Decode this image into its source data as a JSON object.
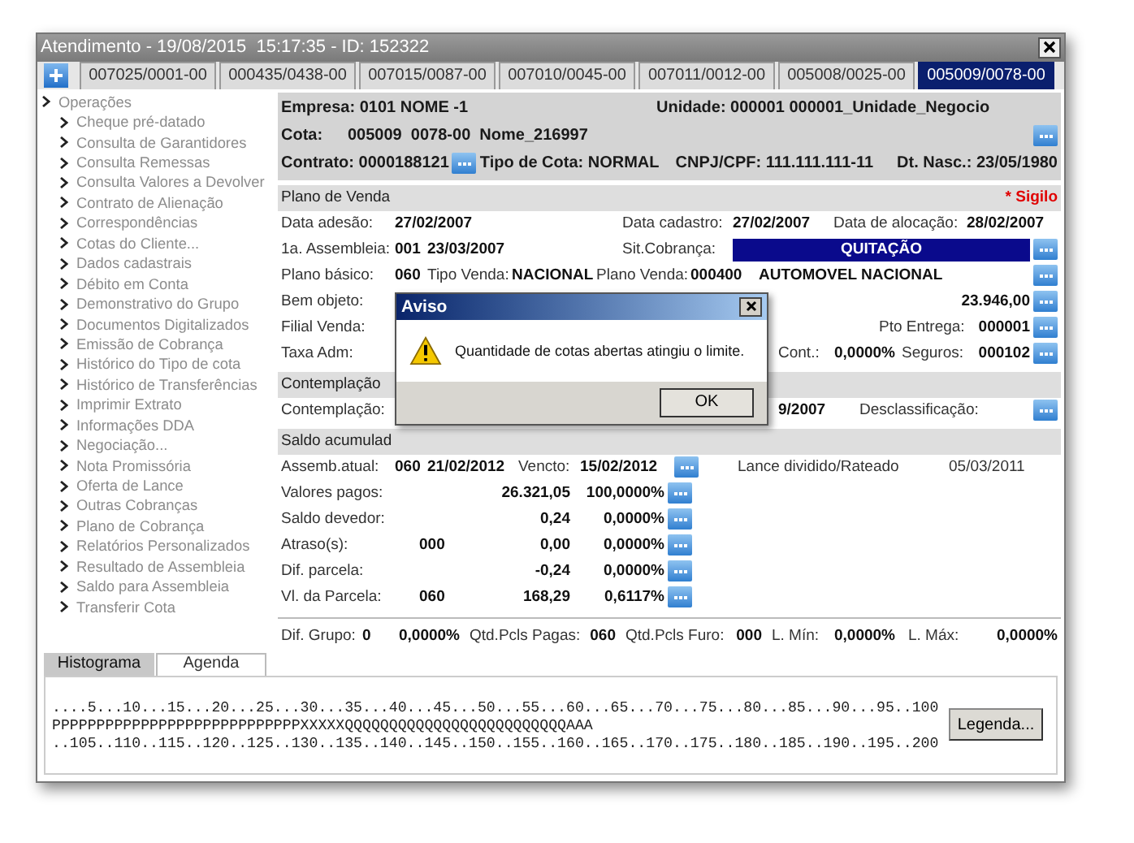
{
  "window": {
    "title": "Atendimento - 19/08/2015  15:17:35 - ID: 152322"
  },
  "tabs": [
    {
      "label": "007025/0001-00",
      "selected": false
    },
    {
      "label": "000435/0438-00",
      "selected": false
    },
    {
      "label": "007015/0087-00",
      "selected": false
    },
    {
      "label": "007010/0045-00",
      "selected": false
    },
    {
      "label": "007011/0012-00",
      "selected": false
    },
    {
      "label": "005008/0025-00",
      "selected": false
    },
    {
      "label": "005009/0078-00",
      "selected": true
    }
  ],
  "sidebar": {
    "items": [
      {
        "label": "Operações",
        "children": [
          {
            "label": "Cheque pré-datado"
          },
          {
            "label": "Consulta de Garantidores"
          },
          {
            "label": "Consulta Remessas"
          },
          {
            "label": "Consulta Valores a Devolver"
          },
          {
            "label": "Contrato de Alienação"
          },
          {
            "label": "Correspondências"
          },
          {
            "label": "Cotas do Cliente..."
          },
          {
            "label": "Dados cadastrais"
          },
          {
            "label": "Débito em Conta"
          },
          {
            "label": "Demonstrativo do Grupo"
          },
          {
            "label": "Documentos Digitalizados"
          },
          {
            "label": "Emissão de Cobrança"
          },
          {
            "label": "Histórico do Tipo de cota"
          },
          {
            "label": "Histórico de Transferências"
          },
          {
            "label": "Imprimir Extrato"
          },
          {
            "label": "Informações DDA"
          },
          {
            "label": "Negociação..."
          },
          {
            "label": "Nota Promissória"
          },
          {
            "label": "Oferta de Lance"
          },
          {
            "label": "Outras Cobranças"
          },
          {
            "label": "Plano de Cobrança"
          },
          {
            "label": "Relatórios Personalizados"
          },
          {
            "label": "Resultado de Assembleia"
          },
          {
            "label": "Saldo para Assembleia"
          },
          {
            "label": "Transferir Cota"
          }
        ]
      }
    ]
  },
  "header": {
    "empresa": "Empresa: 0101 NOME -1",
    "unidade": "Unidade: 000001 000001_Unidade_Negocio",
    "cota_label": "Cota:",
    "cota": "005009  0078-00  Nome_216997",
    "contrato": "Contrato: 0000188121",
    "tipo_cota": "Tipo de Cota: NORMAL",
    "cnpj": "CNPJ/CPF: 111.111.111-11",
    "nascimento": "Dt. Nasc.: 23/05/1980"
  },
  "sections": [
    {
      "title": "Plano de Venda",
      "note": "* Sigilo",
      "rows": [
        {
          "fields": [
            {
              "kind": "label",
              "text": "Data adesão:"
            },
            {
              "kind": "value",
              "text": "27/02/2007"
            },
            {
              "kind": "label",
              "text": "Data cadastro:"
            },
            {
              "kind": "value",
              "text": "27/02/2007"
            },
            {
              "kind": "label",
              "text": "Data de alocação:"
            },
            {
              "kind": "value",
              "text": "28/02/2007"
            }
          ]
        },
        {
          "fields": [
            {
              "kind": "label",
              "text": "1a. Assembleia:"
            },
            {
              "kind": "value",
              "text": "001"
            },
            {
              "kind": "value",
              "text": "23/03/2007"
            },
            {
              "kind": "label",
              "text": "Sit.Cobrança:"
            },
            {
              "kind": "status",
              "text": "QUITAÇÃO"
            },
            {
              "kind": "more"
            }
          ]
        },
        {
          "fields": [
            {
              "kind": "label",
              "text": "Plano básico:"
            },
            {
              "kind": "value",
              "text": "060"
            },
            {
              "kind": "label",
              "text": "Tipo Venda:"
            },
            {
              "kind": "value",
              "text": "NACIONAL"
            },
            {
              "kind": "label",
              "text": "Plano Venda:"
            },
            {
              "kind": "value",
              "text": "000400"
            },
            {
              "kind": "value",
              "text": "AUTOMOVEL NACIONAL"
            },
            {
              "kind": "more"
            }
          ]
        },
        {
          "fields": [
            {
              "kind": "label",
              "text": "Bem objeto:"
            },
            {
              "kind": "amount",
              "text": "23.946,00"
            },
            {
              "kind": "more"
            }
          ]
        },
        {
          "fields": [
            {
              "kind": "label",
              "text": "Filial Venda:"
            },
            {
              "kind": "label",
              "text": "Pto Entrega:"
            },
            {
              "kind": "amount",
              "text": "000001"
            },
            {
              "kind": "more"
            }
          ]
        },
        {
          "fields": [
            {
              "kind": "label",
              "text": "Taxa Adm:"
            },
            {
              "kind": "label",
              "text": "Cont.:"
            },
            {
              "kind": "amount",
              "text": "0,0000%"
            },
            {
              "kind": "label",
              "text": "Seguros:"
            },
            {
              "kind": "amount",
              "text": "000102"
            },
            {
              "kind": "more"
            }
          ]
        }
      ]
    },
    {
      "title": "Contemplação",
      "rows": [
        {
          "fields": [
            {
              "kind": "label",
              "text": "Contemplação:"
            },
            {
              "kind": "value",
              "text": "9/2007"
            },
            {
              "kind": "label",
              "text": "Desclassificação:"
            },
            {
              "kind": "more"
            }
          ]
        }
      ]
    },
    {
      "title": "Saldo acumulad",
      "rows": [
        {
          "fields": [
            {
              "kind": "label",
              "text": "Assemb.atual:"
            },
            {
              "kind": "value",
              "text": "060"
            },
            {
              "kind": "value",
              "text": "21/02/2012"
            },
            {
              "kind": "label",
              "text": "Vencto:"
            },
            {
              "kind": "value",
              "text": "15/02/2012"
            },
            {
              "kind": "more"
            },
            {
              "kind": "label",
              "text": "Lance dividido/Rateado"
            },
            {
              "kind": "label",
              "text": "05/03/2011"
            }
          ]
        },
        {
          "fields": [
            {
              "kind": "label",
              "text": "Valores pagos:"
            },
            {
              "kind": "amount",
              "text": "26.321,05"
            },
            {
              "kind": "amount",
              "text": "100,0000%"
            },
            {
              "kind": "more"
            }
          ]
        },
        {
          "fields": [
            {
              "kind": "label",
              "text": "Saldo devedor:"
            },
            {
              "kind": "amount",
              "text": "0,24"
            },
            {
              "kind": "amount",
              "text": "0,0000%"
            },
            {
              "kind": "more"
            }
          ]
        },
        {
          "fields": [
            {
              "kind": "label",
              "text": "Atraso(s):"
            },
            {
              "kind": "value",
              "text": "000"
            },
            {
              "kind": "amount",
              "text": "0,00"
            },
            {
              "kind": "amount",
              "text": "0,0000%"
            },
            {
              "kind": "more"
            }
          ]
        },
        {
          "fields": [
            {
              "kind": "label",
              "text": "Dif. parcela:"
            },
            {
              "kind": "amount",
              "text": "-0,24"
            },
            {
              "kind": "amount",
              "text": "0,0000%"
            },
            {
              "kind": "more"
            }
          ]
        },
        {
          "fields": [
            {
              "kind": "label",
              "text": "Vl. da Parcela:"
            },
            {
              "kind": "value",
              "text": "060"
            },
            {
              "kind": "amount",
              "text": "168,29"
            },
            {
              "kind": "amount",
              "text": "0,6117%"
            },
            {
              "kind": "more"
            }
          ]
        }
      ]
    },
    {
      "rows": [
        {
          "fields": [
            {
              "kind": "label",
              "text": "Dif. Grupo:"
            },
            {
              "kind": "value",
              "text": "0"
            },
            {
              "kind": "amount",
              "text": "0,0000%"
            },
            {
              "kind": "label",
              "text": "Qtd.Pcls Pagas:"
            },
            {
              "kind": "amount",
              "text": "060"
            },
            {
              "kind": "label",
              "text": "Qtd.Pcls Furo:"
            },
            {
              "kind": "amount",
              "text": "000"
            },
            {
              "kind": "label",
              "text": "L. Mín:"
            },
            {
              "kind": "amount",
              "text": "0,0000%"
            },
            {
              "kind": "label",
              "text": "L. Máx:"
            },
            {
              "kind": "amount",
              "text": "0,0000%"
            }
          ]
        }
      ]
    }
  ],
  "dialog": {
    "title": "Aviso",
    "message": "Quantidade de cotas abertas atingiu o limite.",
    "button": "OK"
  },
  "bottom_tabs": [
    {
      "label": "Histograma",
      "selected": true
    },
    {
      "label": "Agenda",
      "selected": false
    }
  ],
  "histogram": {
    "lines": [
      "....5...10...15...20...25...30...35...40...45...50...55...60...65...70...75...80...85...90...95..100",
      "PPPPPPPPPPPPPPPPPPPPPPPPPPPPXXXXXQQQQQQQQQQQQQQQQQQQQQQQQQAAA",
      "..105..110..115..120..125..130..135..140..145..150..155..160..165..170..175..180..185..190..195..200"
    ],
    "button": "Legenda..."
  }
}
